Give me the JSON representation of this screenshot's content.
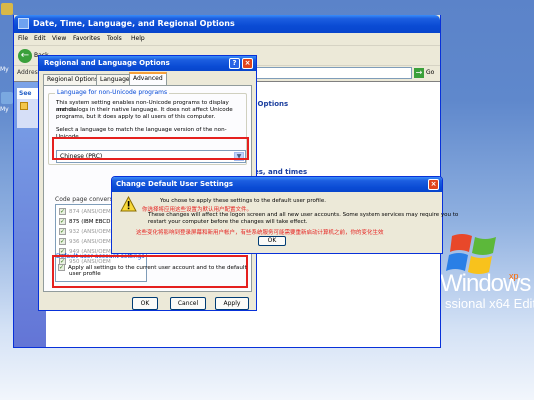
{
  "explorer": {
    "title": "Date, Time, Language, and Regional Options",
    "menu": [
      "File",
      "Edit",
      "View",
      "Favorites",
      "Tools",
      "Help"
    ],
    "back_label": "Back",
    "address_label": "Address",
    "go_label": "Go",
    "taskpane_header": "See",
    "content_heading": "nal Options",
    "content_link": "es, and times"
  },
  "regional_dialog": {
    "title": "Regional and Language Options",
    "help_symbol": "?",
    "close_symbol": "×",
    "tabs": [
      "Regional Options",
      "Languages",
      "Advanced"
    ],
    "active_tab": "Advanced",
    "group1_title": "Language for non-Unicode programs",
    "description": [
      "This system setting enables non-Unicode programs to display menus",
      "and dialogs in their native language. It does not affect Unicode",
      "programs, but it does apply to all users of this computer."
    ],
    "select_prompt": "Select a language to match the language version of the non-Unicode",
    "selected_language": "Chinese (PRC)",
    "codepage_label": "Code page conversion tables",
    "codepages": [
      {
        "label": "874   (ANSI/OEM",
        "checked": true,
        "strong": false
      },
      {
        "label": "875   (IBM EBCDIC",
        "checked": true,
        "strong": true
      },
      {
        "label": "932   (ANSI/OEM",
        "checked": true,
        "strong": false
      },
      {
        "label": "936   (ANSI/OEM",
        "checked": true,
        "strong": false
      },
      {
        "label": "949   (ANSI/OEM",
        "checked": true,
        "strong": false
      },
      {
        "label": "950   (ANSI/OEM",
        "checked": true,
        "strong": false
      }
    ],
    "default_user_title": "Default user account settings",
    "apply_all_text_1": "Apply all settings to the current user account and to the default",
    "apply_all_text_2": "user profile",
    "apply_all_checked": true,
    "ok_label": "OK",
    "cancel_label": "Cancel",
    "apply_label": "Apply"
  },
  "change_dialog": {
    "title": "Change Default User Settings",
    "close_symbol": "×",
    "line1": "You chose to apply these settings to the default user profile.",
    "line1_cn": "你选择将应用这些设置为默认用户配置文件。",
    "line2": "These changes will affect the logon screen and all new user accounts. Some system services may require you to",
    "line3": "restart your computer before the changes will take effect.",
    "line3_cn": "这些变化将影响到登录屏幕和新用户帐户，有些系统服务可能需要重新启动计算机之前，你的变化生效",
    "ok_label": "OK"
  },
  "desktop": {
    "brand_line1": "Windows",
    "brand_xp": "xp",
    "brand_line2": "ssional x64 Edition",
    "icon_labels": [
      "My",
      "My"
    ]
  },
  "colors": {
    "titlebar": "#0a4bd4",
    "highlight_box": "#e5201e",
    "window_face": "#ece9d8"
  }
}
